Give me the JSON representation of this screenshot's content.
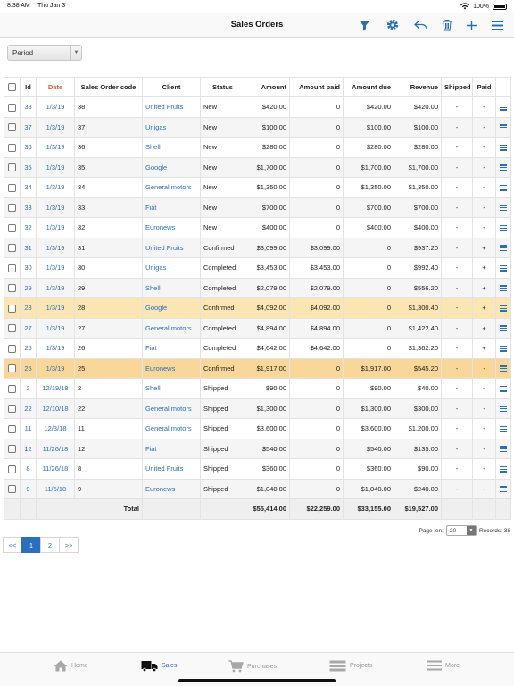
{
  "status_bar": {
    "time": "8:38 AM",
    "date": "Thu Jan 3",
    "battery": "100%"
  },
  "navbar": {
    "title": "Sales Orders"
  },
  "filter": {
    "period_label": "Period"
  },
  "table": {
    "headers": [
      "Id",
      "Date",
      "Sales Order code",
      "Client",
      "Status",
      "Amount",
      "Amount paid",
      "Amount due",
      "Revenue",
      "Shipped",
      "Paid"
    ],
    "rows": [
      {
        "id": "38",
        "date": "1/3/19",
        "code": "38",
        "client": "United Fruits",
        "status": "New",
        "amount": "$420.00",
        "paid": "0",
        "due": "$420.00",
        "revenue": "$420.00",
        "shipped": "-",
        "paid_flag": "-"
      },
      {
        "id": "37",
        "date": "1/3/19",
        "code": "37",
        "client": "Unigas",
        "status": "New",
        "amount": "$100.00",
        "paid": "0",
        "due": "$100.00",
        "revenue": "$100.00",
        "shipped": "-",
        "paid_flag": "-"
      },
      {
        "id": "36",
        "date": "1/3/19",
        "code": "36",
        "client": "Shell",
        "status": "New",
        "amount": "$280.00",
        "paid": "0",
        "due": "$280.00",
        "revenue": "$280.00",
        "shipped": "-",
        "paid_flag": "-"
      },
      {
        "id": "35",
        "date": "1/3/19",
        "code": "35",
        "client": "Google",
        "status": "New",
        "amount": "$1,700.00",
        "paid": "0",
        "due": "$1,700.00",
        "revenue": "$1,700.00",
        "shipped": "-",
        "paid_flag": "-"
      },
      {
        "id": "34",
        "date": "1/3/19",
        "code": "34",
        "client": "General motors",
        "status": "New",
        "amount": "$1,350.00",
        "paid": "0",
        "due": "$1,350.00",
        "revenue": "$1,350.00",
        "shipped": "-",
        "paid_flag": "-"
      },
      {
        "id": "33",
        "date": "1/3/19",
        "code": "33",
        "client": "Fiat",
        "status": "New",
        "amount": "$700.00",
        "paid": "0",
        "due": "$700.00",
        "revenue": "$700.00",
        "shipped": "-",
        "paid_flag": "-"
      },
      {
        "id": "32",
        "date": "1/3/19",
        "code": "32",
        "client": "Euronews",
        "status": "New",
        "amount": "$400.00",
        "paid": "0",
        "due": "$400.00",
        "revenue": "$400.00",
        "shipped": "-",
        "paid_flag": "-"
      },
      {
        "id": "31",
        "date": "1/3/19",
        "code": "31",
        "client": "United Fruits",
        "status": "Confirmed",
        "amount": "$3,099.00",
        "paid": "$3,099.00",
        "due": "0",
        "revenue": "$937.20",
        "shipped": "-",
        "paid_flag": "+"
      },
      {
        "id": "30",
        "date": "1/3/19",
        "code": "30",
        "client": "Unigas",
        "status": "Completed",
        "amount": "$3,453.00",
        "paid": "$3,453.00",
        "due": "0",
        "revenue": "$992.40",
        "shipped": "-",
        "paid_flag": "+"
      },
      {
        "id": "29",
        "date": "1/3/19",
        "code": "29",
        "client": "Shell",
        "status": "Completed",
        "amount": "$2,079.00",
        "paid": "$2,079.00",
        "due": "0",
        "revenue": "$556.20",
        "shipped": "-",
        "paid_flag": "+"
      },
      {
        "id": "28",
        "date": "1/3/19",
        "code": "28",
        "client": "Google",
        "status": "Confirmed",
        "amount": "$4,092.00",
        "paid": "$4,092.00",
        "due": "0",
        "revenue": "$1,300.40",
        "shipped": "-",
        "paid_flag": "+",
        "hl": "hl"
      },
      {
        "id": "27",
        "date": "1/3/19",
        "code": "27",
        "client": "General motors",
        "status": "Completed",
        "amount": "$4,894.00",
        "paid": "$4,894.00",
        "due": "0",
        "revenue": "$1,422.40",
        "shipped": "-",
        "paid_flag": "+"
      },
      {
        "id": "26",
        "date": "1/3/19",
        "code": "26",
        "client": "Fiat",
        "status": "Completed",
        "amount": "$4,642.00",
        "paid": "$4,642.00",
        "due": "0",
        "revenue": "$1,362.20",
        "shipped": "-",
        "paid_flag": "+"
      },
      {
        "id": "25",
        "date": "1/3/19",
        "code": "25",
        "client": "Euronews",
        "status": "Confirmed",
        "amount": "$1,917.00",
        "paid": "0",
        "due": "$1,917.00",
        "revenue": "$545.20",
        "shipped": "-",
        "paid_flag": "-",
        "hl": "hl2"
      },
      {
        "id": "2",
        "date": "12/19/18",
        "code": "2",
        "client": "Shell",
        "status": "Shipped",
        "amount": "$90.00",
        "paid": "0",
        "due": "$90.00",
        "revenue": "$40.00",
        "shipped": "-",
        "paid_flag": "-"
      },
      {
        "id": "22",
        "date": "12/10/18",
        "code": "22",
        "client": "General motors",
        "status": "Shipped",
        "amount": "$1,300.00",
        "paid": "0",
        "due": "$1,300.00",
        "revenue": "$300.00",
        "shipped": "-",
        "paid_flag": "-"
      },
      {
        "id": "11",
        "date": "12/3/18",
        "code": "11",
        "client": "General motors",
        "status": "Shipped",
        "amount": "$3,600.00",
        "paid": "0",
        "due": "$3,600.00",
        "revenue": "$1,200.00",
        "shipped": "-",
        "paid_flag": "-"
      },
      {
        "id": "12",
        "date": "11/26/18",
        "code": "12",
        "client": "Fiat",
        "status": "Shipped",
        "amount": "$540.00",
        "paid": "0",
        "due": "$540.00",
        "revenue": "$135.00",
        "shipped": "-",
        "paid_flag": "-"
      },
      {
        "id": "8",
        "date": "11/26/18",
        "code": "8",
        "client": "United Fruits",
        "status": "Shipped",
        "amount": "$360.00",
        "paid": "0",
        "due": "$360.00",
        "revenue": "$90.00",
        "shipped": "-",
        "paid_flag": "-"
      },
      {
        "id": "9",
        "date": "11/5/18",
        "code": "9",
        "client": "Euronews",
        "status": "Shipped",
        "amount": "$1,040.00",
        "paid": "0",
        "due": "$1,040.00",
        "revenue": "$240.00",
        "shipped": "-",
        "paid_flag": "-"
      }
    ],
    "totals": {
      "label": "Total",
      "amount": "$55,414.00",
      "paid": "$22,259.00",
      "due": "$33,155.00",
      "revenue": "$19,527.00"
    }
  },
  "pagination": {
    "first": "<<",
    "pages": [
      "1",
      "2"
    ],
    "active": "1",
    "last": ">>"
  },
  "page_len": {
    "label": "Page len:",
    "value": "20",
    "records": "Records: 38"
  },
  "tabbar": [
    {
      "key": "home",
      "label": "Home"
    },
    {
      "key": "sales",
      "label": "Sales",
      "active": true
    },
    {
      "key": "purchases",
      "label": "Purchases"
    },
    {
      "key": "projects",
      "label": "Projects"
    },
    {
      "key": "more",
      "label": "More"
    }
  ],
  "colors": {
    "accent": "#2a6fbd",
    "highlight": "#fbe6b3",
    "highlight_strong": "#f9d69a",
    "date_header": "#e05a3a"
  }
}
